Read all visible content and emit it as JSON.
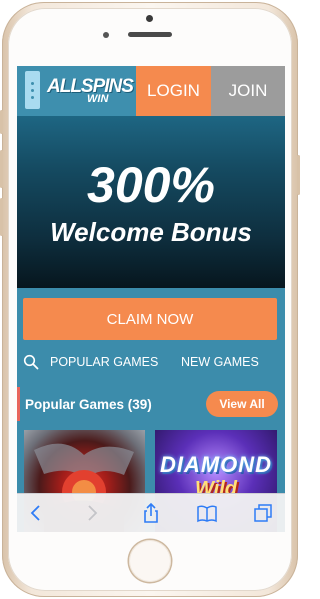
{
  "header": {
    "logo_main": "ALLSPINS",
    "logo_sub": "WIN",
    "login_label": "LOGIN",
    "join_label": "JOIN",
    "menu_icon": "more-vertical-icon"
  },
  "banner": {
    "percent": "300%",
    "subtitle": "Welcome Bonus"
  },
  "claim": {
    "label": "CLAIM NOW"
  },
  "tabs": {
    "search_icon": "search-icon",
    "popular": "POPULAR GAMES",
    "new": "NEW GAMES"
  },
  "popular": {
    "title": "Popular Games (39)",
    "view_all": "View All"
  },
  "games": [
    {
      "name": "dragon-slot",
      "title_line1": "",
      "title_line2": ""
    },
    {
      "name": "diamond-wild",
      "title_line1": "DIAMOND",
      "title_line2": "Wild"
    }
  ],
  "safari_toolbar": {
    "icons": [
      "back-icon",
      "forward-icon",
      "share-icon",
      "bookmarks-icon",
      "tabs-icon"
    ]
  },
  "colors": {
    "header_bg": "#3e8fae",
    "accent_orange": "#f58a4e",
    "join_gray": "#9c9c9c",
    "content_bg": "#3c8cab",
    "banner_dark": "#07161e"
  }
}
